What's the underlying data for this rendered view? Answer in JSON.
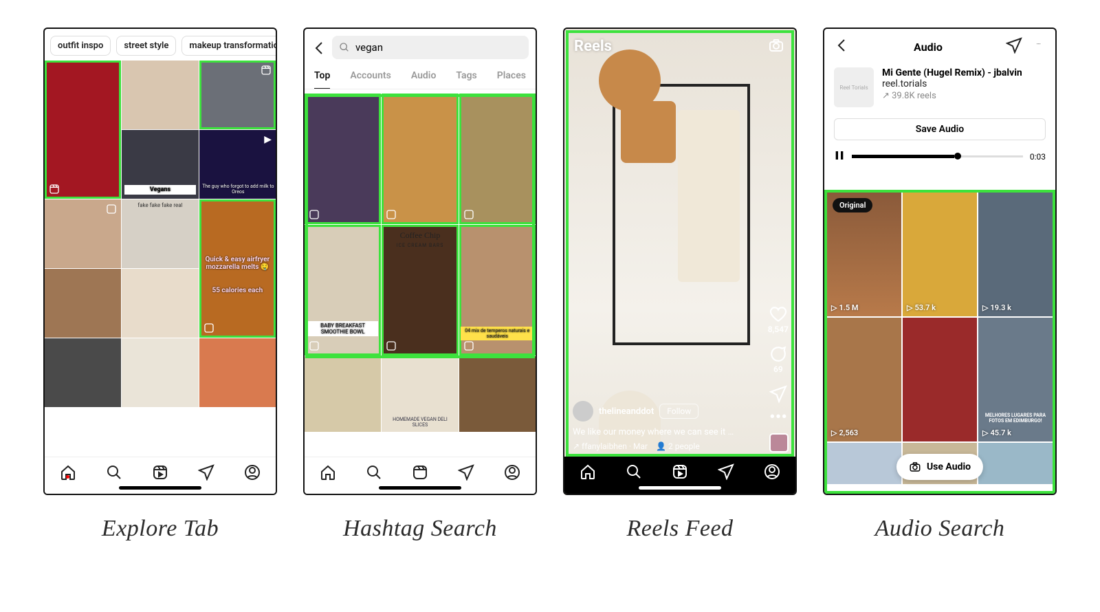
{
  "captions": {
    "explore": "Explore Tab",
    "hashtag": "Hashtag Search",
    "reels": "Reels Feed",
    "audio": "Audio Search"
  },
  "explore": {
    "chips": [
      "outfit inspo",
      "street style",
      "makeup transformation"
    ],
    "cells": {
      "vegans_label": "Vegans",
      "oreo_label": "The guy who forgot to add milk to Oreos",
      "fake_real": "fake   fake   fake   real",
      "airfryer_line1": "Quick & easy airfryer mozzarella melts 🤤",
      "airfryer_line2": "55 calories each"
    }
  },
  "hashtag": {
    "search_value": "vegan",
    "tabs": [
      "Top",
      "Accounts",
      "Audio",
      "Tags",
      "Places"
    ],
    "active_tab": "Top",
    "cells": {
      "coffee_title": "Coffee Chip",
      "coffee_sub": "ICE CREAM BARS",
      "smoothie": "BABY BREAKFAST SMOOTHIE BOWL",
      "temperos": "04 mix de temperos naturais e saudáveis",
      "deli": "HOMEMADE VEGAN DELI SLICES"
    }
  },
  "reels": {
    "title": "Reels",
    "username": "thelineanddot",
    "follow": "Follow",
    "caption": "We like our money where we can see it …",
    "audio_attr": "ffanylaibhen · Mar",
    "tagged": "2 people",
    "likes": "8,547",
    "comments": "69"
  },
  "audio": {
    "header": "Audio",
    "track_title": "Mi Gente (Hugel Remix) - jbalvin",
    "track_artist": "reel.torials",
    "reel_count": "39.8K reels",
    "save": "Save Audio",
    "time": "0:03",
    "original_badge": "Original",
    "use_audio": "Use Audio",
    "grid_views": [
      "1.5 M",
      "53.7 k",
      "19.3 k",
      "2,563",
      "",
      "45.7 k"
    ],
    "edimburgo": "MELHORES LUGARES PARA FOTOS EM EDIMBURGO!"
  }
}
